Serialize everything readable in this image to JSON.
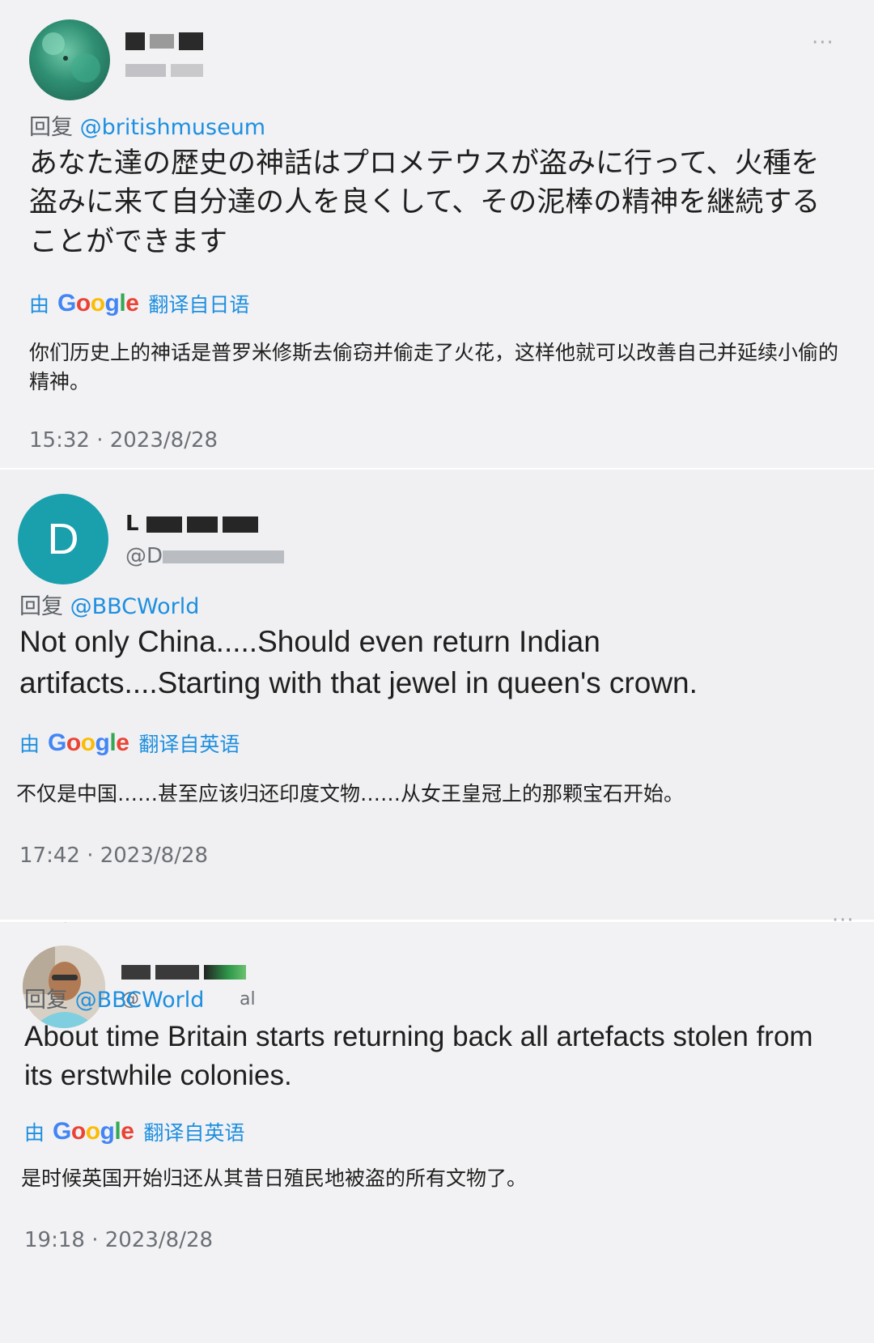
{
  "tweets": [
    {
      "display_name": "",
      "username": "",
      "reply_label": "回复",
      "reply_handle": "@britishmuseum",
      "text": "あなた達の歴史の神話はプロメテウスが盗みに行って、火種を盗みに来て自分達の人を良くして、その泥棒の精神を継続することができます",
      "translate_by": "由",
      "translate_brand": "Google",
      "translate_label": "翻译自日语",
      "translation": "你们历史上的神话是普罗米修斯去偷窃并偷走了火花，这样他就可以改善自己并延续小偷的精神。",
      "timestamp": "15:32 · 2023/8/28",
      "more_icon": "more-horizontal-icon"
    },
    {
      "avatar_letter": "D",
      "avatar_color": "#1a9fad",
      "display_name": "L",
      "username": "@D",
      "reply_label": "回复",
      "reply_handle": "@BBCWorld",
      "text": "Not only China.....Should even return Indian artifacts....Starting with that jewel in queen's crown.",
      "translate_by": "由",
      "translate_brand": "Google",
      "translate_label": "翻译自英语",
      "translation": "不仅是中国……甚至应该归还印度文物……从女王皇冠上的那颗宝石开始。",
      "timestamp": "17:42 · 2023/8/28"
    },
    {
      "display_name": "",
      "username": "@",
      "username_tail": "al",
      "reply_label": "回复",
      "reply_handle": "@BBCWorld",
      "text": "About time Britain starts returning back all artefacts stolen from its erstwhile colonies.",
      "translate_by": "由",
      "translate_brand": "Google",
      "translate_label": "翻译自英语",
      "translation": "是时候英国开始归还从其昔日殖民地被盗的所有文物了。",
      "timestamp": "19:18 · 2023/8/28",
      "more_icon": "more-horizontal-icon"
    }
  ],
  "colors": {
    "link": "#1d8fe0",
    "background": "#f2f2f4",
    "text": "#1f1f1f",
    "secondary": "#6b7075"
  }
}
